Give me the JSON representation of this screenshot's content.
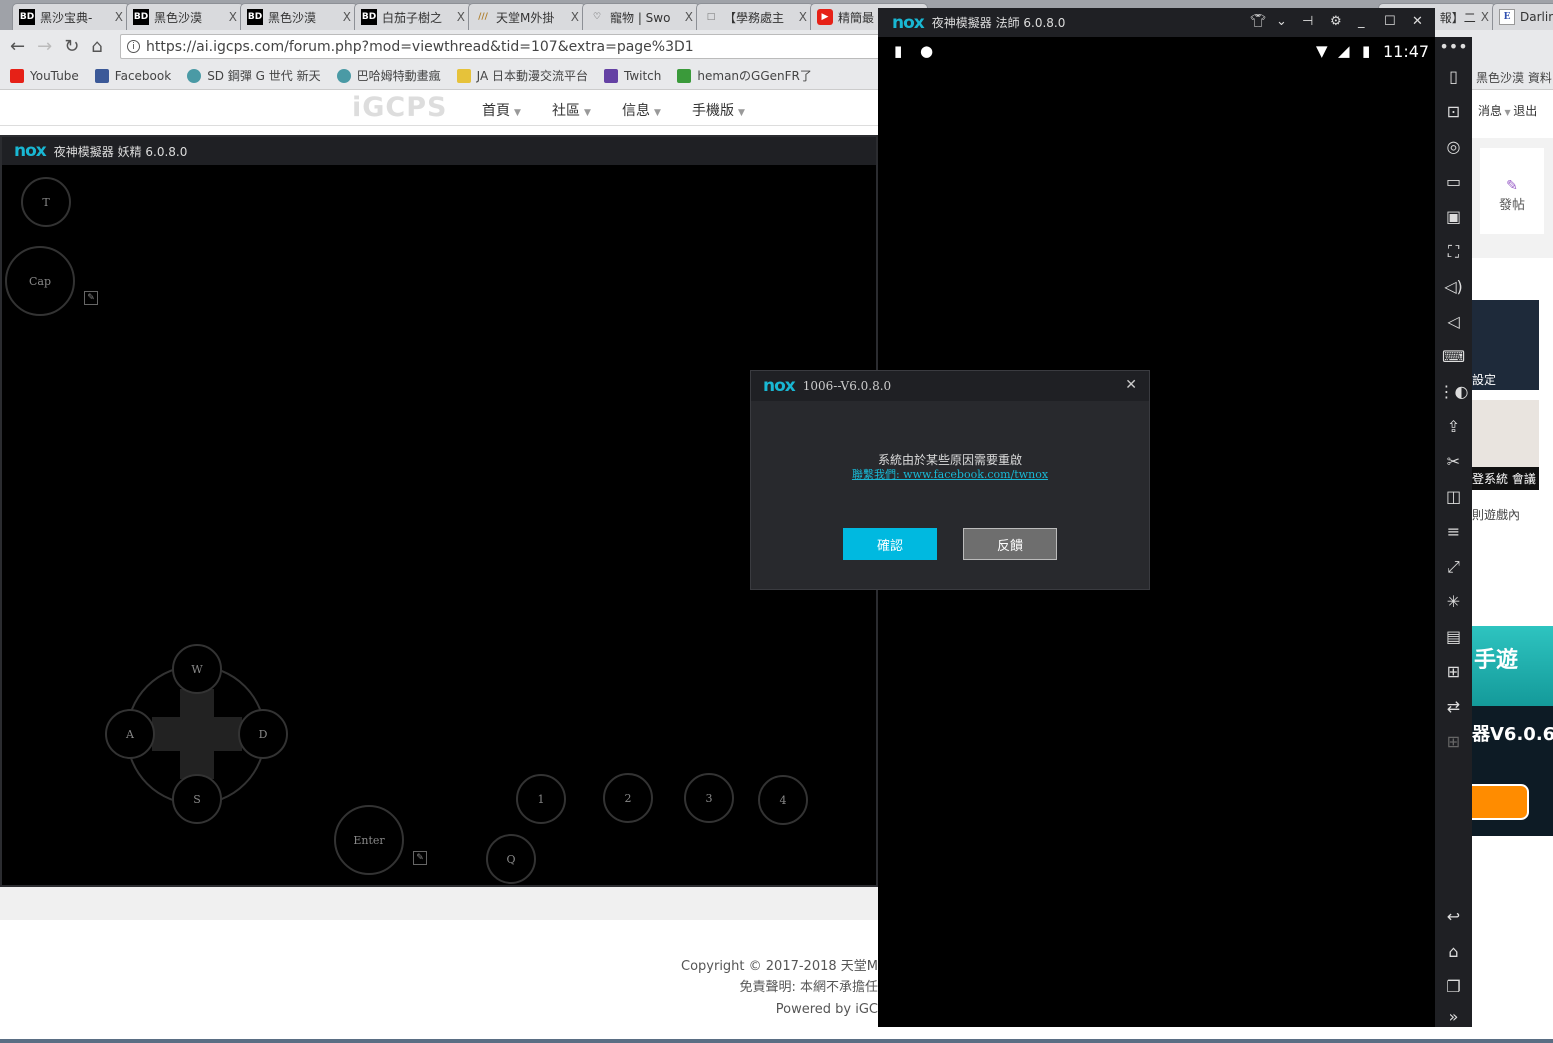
{
  "browser": {
    "tabs": [
      {
        "icon": "BD",
        "label": "黑沙宝典-"
      },
      {
        "icon": "BD",
        "label": "黑色沙漠"
      },
      {
        "icon": "BD",
        "label": "黑色沙漠"
      },
      {
        "icon": "BD",
        "label": "白茄子樹之"
      },
      {
        "icon": "///",
        "label": "天堂M外掛"
      },
      {
        "icon": "♡",
        "label": "寵物 | Swo"
      },
      {
        "icon": "□",
        "label": "【學務處主"
      },
      {
        "icon": "▶",
        "label": "精簡最"
      },
      {
        "icon": "",
        "label": "報】二"
      },
      {
        "icon": "E",
        "label": "Darlin"
      }
    ],
    "close_glyph": "X",
    "url": "https://ai.igcps.com/forum.php?mod=viewthread&tid=107&extra=page%3D1",
    "bookmarks": [
      {
        "label": "YouTube",
        "color": "#e62117"
      },
      {
        "label": "Facebook",
        "color": "#3b5998"
      },
      {
        "label": "SD 鋼彈 G 世代 新天",
        "color": "#4a9aa5"
      },
      {
        "label": "巴哈姆特動畫瘋",
        "color": "#4a9aa5"
      },
      {
        "label": "JA 日本動漫交流平台",
        "color": "#e6c23a"
      },
      {
        "label": "Twitch",
        "color": "#6441a4"
      },
      {
        "label": "hemanのGGenFR了",
        "color": "#3a9a3a"
      }
    ]
  },
  "site": {
    "logo": "iGCPS",
    "menu": [
      "首頁",
      "社區",
      "信息",
      "手機版"
    ],
    "right_menu": [
      "消息",
      "退出"
    ],
    "right_nav_text": "黑色沙漠 資料",
    "post_button": "發帖",
    "snippets": [
      "設定",
      "登系統 會議",
      "則遊戲內",
      "手遊",
      "器V6.0.6"
    ],
    "footer": [
      "Copyright © 2017-2018 天堂M",
      "免責聲明: 本網不承擔任",
      "Powered by iGC"
    ]
  },
  "left_emulator": {
    "title": "夜神模擬器 妖精 6.0.8.0",
    "keys": {
      "t": "T",
      "cap": "Cap",
      "w": "W",
      "a": "A",
      "s": "S",
      "d": "D",
      "k1": "1",
      "k2": "2",
      "k3": "3",
      "k4": "4",
      "enter": "Enter",
      "q": "Q"
    }
  },
  "right_emulator": {
    "title": "夜神模擬器 法師 6.0.8.0",
    "time": "11:47"
  },
  "dialog": {
    "title": "1006--V6.0.8.0",
    "message": "系統由於某些原因需要重啟",
    "link": "聯繫我們: www.facebook.com/twnox",
    "confirm": "確認",
    "feedback": "反饋",
    "accent": "#00b9e0"
  },
  "logo_text": "nox"
}
